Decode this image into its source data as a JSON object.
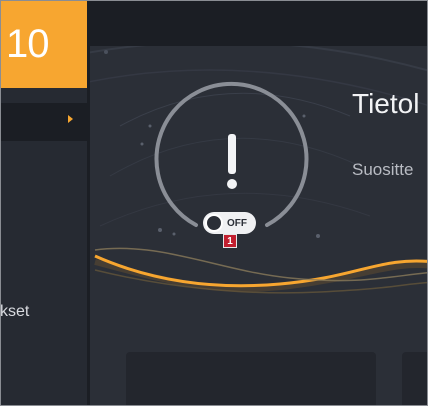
{
  "sidebar": {
    "version": "10",
    "partial_label": "kset"
  },
  "info": {
    "title": "Tietol",
    "subtitle": "Suositte"
  },
  "toggle": {
    "state_label": "OFF"
  },
  "marker": {
    "label": "1"
  },
  "colors": {
    "accent": "#f7a630",
    "background": "#2b2f37",
    "sidebar": "#262a32",
    "marker": "#c21f2f"
  }
}
